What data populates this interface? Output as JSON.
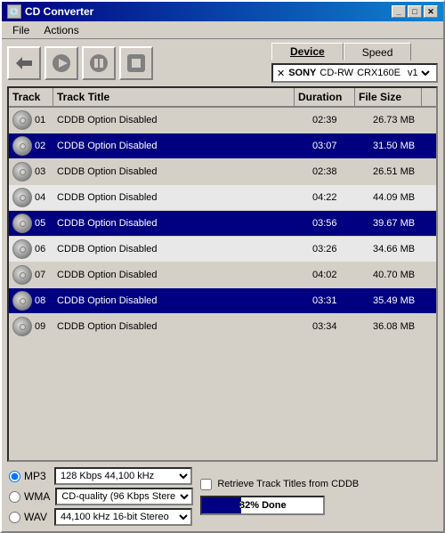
{
  "window": {
    "title": "CD Converter",
    "min_btn": "_",
    "max_btn": "□",
    "close_btn": "✕"
  },
  "menu": {
    "file_label": "File",
    "actions_label": "Actions"
  },
  "toolbar": {
    "device_tab": "Device",
    "speed_tab": "Speed",
    "device_icon": "✕",
    "device_brand": "SONY",
    "device_type": "CD-RW",
    "device_model": "CRX160E",
    "device_version": "v1"
  },
  "table": {
    "col_track": "Track",
    "col_title": "Track Title",
    "col_duration": "Duration",
    "col_filesize": "File Size",
    "rows": [
      {
        "num": "01",
        "title": "CDDB Option Disabled",
        "duration": "02:39",
        "filesize": "26.73 MB",
        "selected": false
      },
      {
        "num": "02",
        "title": "CDDB Option Disabled",
        "duration": "03:07",
        "filesize": "31.50 MB",
        "selected": true
      },
      {
        "num": "03",
        "title": "CDDB Option Disabled",
        "duration": "02:38",
        "filesize": "26.51 MB",
        "selected": false
      },
      {
        "num": "04",
        "title": "CDDB Option Disabled",
        "duration": "04:22",
        "filesize": "44.09 MB",
        "selected": false
      },
      {
        "num": "05",
        "title": "CDDB Option Disabled",
        "duration": "03:56",
        "filesize": "39.67 MB",
        "selected": true
      },
      {
        "num": "06",
        "title": "CDDB Option Disabled",
        "duration": "03:26",
        "filesize": "34.66 MB",
        "selected": false
      },
      {
        "num": "07",
        "title": "CDDB Option Disabled",
        "duration": "04:02",
        "filesize": "40.70 MB",
        "selected": false
      },
      {
        "num": "08",
        "title": "CDDB Option Disabled",
        "duration": "03:31",
        "filesize": "35.49 MB",
        "selected": true
      },
      {
        "num": "09",
        "title": "CDDB Option Disabled",
        "duration": "03:34",
        "filesize": "36.08 MB",
        "selected": false
      }
    ]
  },
  "bottom": {
    "formats": [
      {
        "id": "mp3",
        "label": "MP3",
        "checked": true
      },
      {
        "id": "wma",
        "label": "WMA",
        "checked": false
      },
      {
        "id": "wav",
        "label": "WAV",
        "checked": false
      }
    ],
    "format_options": {
      "mp3": "128 Kbps  44,100 kHz",
      "wma": "CD-quality (96 Kbps Stere",
      "wav": "44,100 kHz  16-bit  Stereo"
    },
    "retrieve_label": "Retrieve Track Titles from CDDB",
    "progress_value": 32,
    "progress_label": "32% Done"
  }
}
